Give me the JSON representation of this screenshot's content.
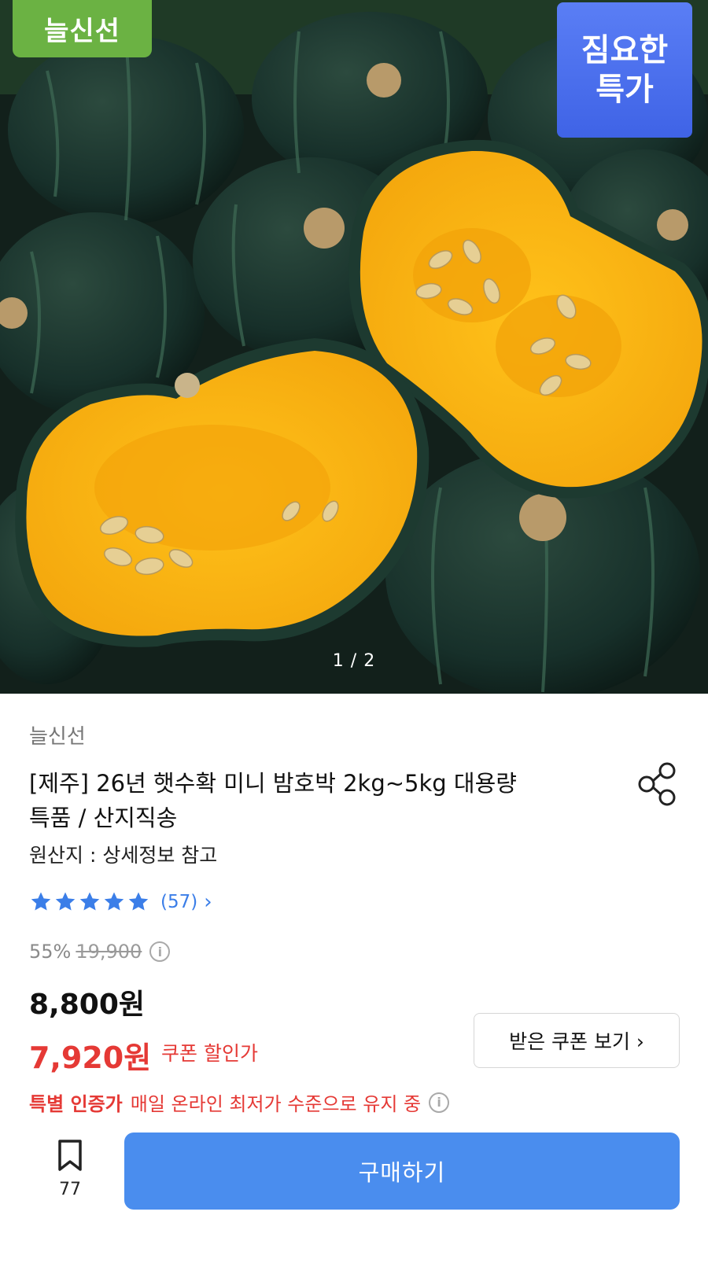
{
  "hero": {
    "badge_left": "늘신선",
    "badge_right_line1": "짐요한",
    "badge_right_line2": "특가",
    "pager": "1 / 2"
  },
  "product": {
    "seller": "늘신선",
    "title_line1": "[제주] 26년 햇수확 미니 밤호박 2kg~5kg 대용량",
    "title_line2": "특품 / 산지직송",
    "origin": "원산지 : 상세정보 참고",
    "rating": {
      "stars": 5,
      "review_count": "(57)"
    },
    "discount_rate": "55%",
    "original_price": "19,900",
    "price": "8,800원",
    "coupon_price": "7,920원",
    "coupon_label": "쿠폰 할인가",
    "coupon_button": "받은 쿠폰 보기 ›",
    "special_highlight": "특별 인증가",
    "special_text": "매일 온라인 최저가 수준으로 유지 중"
  },
  "bottom_bar": {
    "bookmark_count": "77",
    "buy_label": "구매하기"
  },
  "colors": {
    "accent_blue": "#4a8dee",
    "sale_red": "#e53935",
    "badge_green": "#6bb243",
    "badge_blue": "#4a6ff0",
    "star_blue": "#3b7ee8"
  }
}
